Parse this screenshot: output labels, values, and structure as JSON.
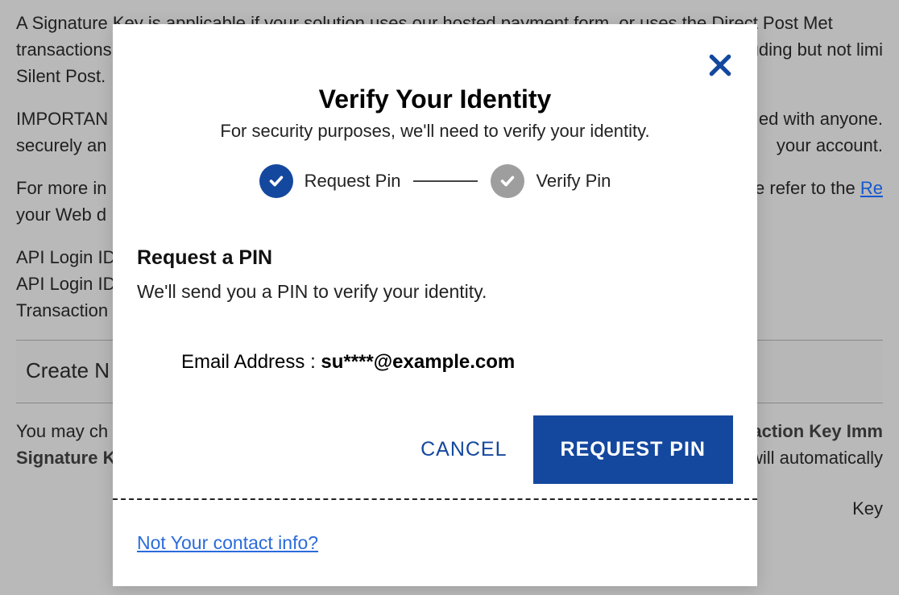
{
  "background": {
    "p1": "A Signature Key is applicable if your solution uses our hosted payment form, or uses the Direct Post Met",
    "p1b": "transactions",
    "p1c": "uding but not limi",
    "p1d": "Silent Post.",
    "p2a": "IMPORTAN",
    "p2b": "ed with anyone.",
    "p2c": "securely an",
    "p2d": "your account.",
    "p3a": "For more in",
    "p3b": "se refer to the ",
    "p3c": "Re",
    "p3d": "your Web d",
    "api1": "API Login ID",
    "api2": "API Login ID",
    "trans": "Transaction",
    "create": "Create N",
    "you_may_a": "You may ch",
    "you_may_b": "saction Key Imm",
    "sig_a": "Signature K",
    "sig_b": "will automatically",
    "key": "Key"
  },
  "modal": {
    "title": "Verify Your Identity",
    "subtitle": "For security purposes, we'll need to verify your identity.",
    "steps": {
      "step1": "Request Pin",
      "step2": "Verify Pin"
    },
    "section_title": "Request a PIN",
    "section_desc": "We'll send you a PIN to verify your identity.",
    "email_label": "Email Address : ",
    "email_value": "su****@example.com",
    "cancel_label": "CANCEL",
    "request_label": "REQUEST PIN",
    "contact_link": "Not Your contact info?"
  }
}
